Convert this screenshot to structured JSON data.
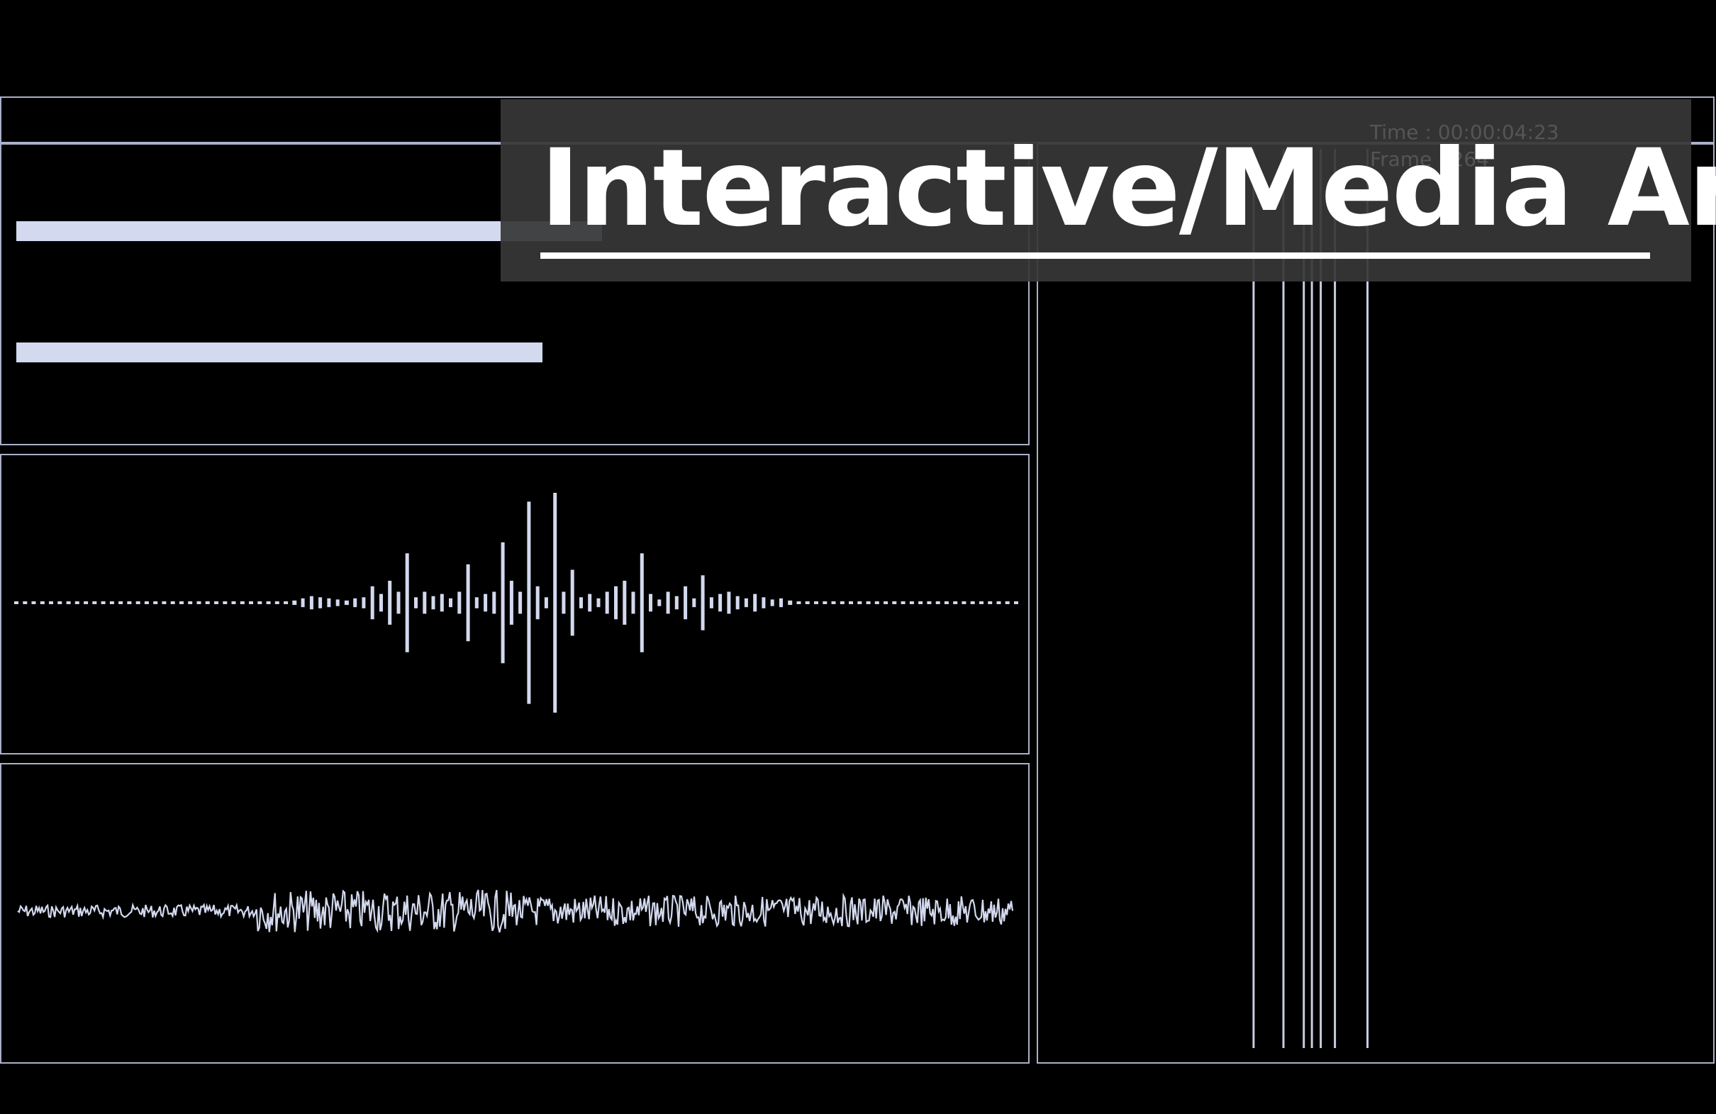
{
  "title": "Interactive/Media Art",
  "overlay_readout": {
    "time_label": "Time :",
    "time_value": "00:00:04:23",
    "frame_label": "Frame :",
    "frame_value": "264"
  },
  "colors": {
    "background": "#000000",
    "panel_border": "#aab0c8",
    "signal": "#d3d9ee",
    "title_box": "#373737",
    "title_text": "#ffffff"
  },
  "level_meters": [
    0.59,
    0.53
  ],
  "pulse_amplitudes": [
    0.01,
    0.01,
    0.01,
    0.01,
    0.01,
    0.01,
    0.01,
    0.01,
    0.01,
    0.01,
    0.01,
    0.01,
    0.01,
    0.01,
    0.01,
    0.01,
    0.01,
    0.01,
    0.01,
    0.01,
    0.01,
    0.01,
    0.01,
    0.01,
    0.01,
    0.01,
    0.01,
    0.01,
    0.01,
    0.01,
    0.01,
    0.01,
    0.02,
    0.04,
    0.06,
    0.05,
    0.04,
    0.03,
    0.02,
    0.04,
    0.05,
    0.15,
    0.08,
    0.2,
    0.1,
    0.45,
    0.05,
    0.1,
    0.06,
    0.08,
    0.04,
    0.1,
    0.35,
    0.05,
    0.08,
    0.1,
    0.55,
    0.2,
    0.1,
    0.92,
    0.15,
    0.05,
    1.0,
    0.1,
    0.3,
    0.05,
    0.08,
    0.04,
    0.1,
    0.15,
    0.2,
    0.1,
    0.45,
    0.08,
    0.03,
    0.1,
    0.06,
    0.15,
    0.04,
    0.25,
    0.05,
    0.08,
    0.1,
    0.06,
    0.04,
    0.08,
    0.05,
    0.03,
    0.04,
    0.02,
    0.01,
    0.01,
    0.01,
    0.01,
    0.01,
    0.01,
    0.01,
    0.01,
    0.01,
    0.01,
    0.01,
    0.01,
    0.01,
    0.01,
    0.01,
    0.01,
    0.01,
    0.01,
    0.01,
    0.01,
    0.01,
    0.01,
    0.01,
    0.01,
    0.01,
    0.01
  ],
  "vertical_lines": [
    0.32,
    0.364,
    0.394,
    0.406,
    0.419,
    0.44,
    0.488
  ]
}
